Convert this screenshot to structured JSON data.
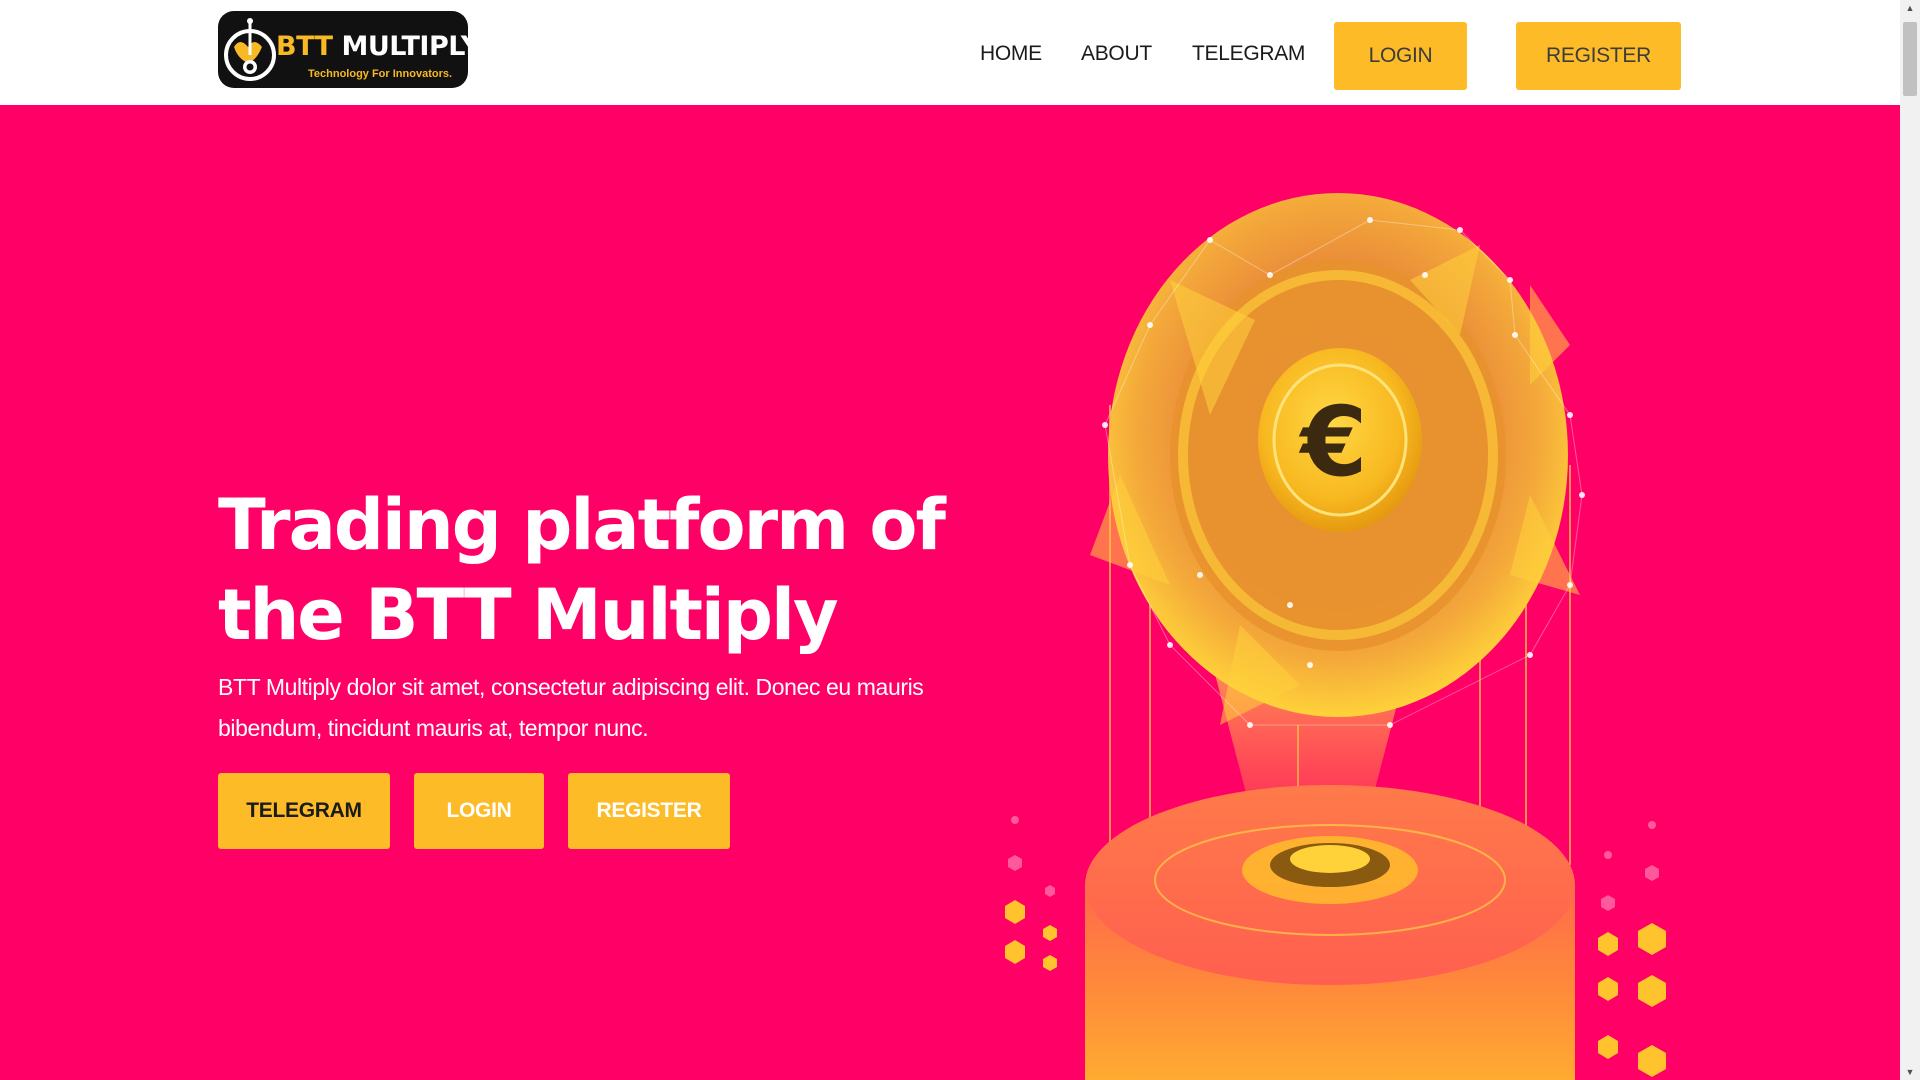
{
  "header": {
    "logo": {
      "name_first": "BTT",
      "name_second": "MULTIPLY",
      "tagline": "Technology For Innovators."
    },
    "nav": {
      "home": "HOME",
      "about": "ABOUT",
      "telegram": "TELEGRAM",
      "login": "LOGIN",
      "register": "REGISTER"
    }
  },
  "hero": {
    "title": "Trading platform of the BTT Multiply",
    "description": "BTT Multiply dolor sit amet, consectetur adipiscing elit. Donec eu mauris bibendum, tincidunt mauris at, tempor nunc.",
    "buttons": {
      "telegram": "TELEGRAM",
      "login": "LOGIN",
      "register": "REGISTER"
    },
    "coin_symbol": "€"
  },
  "colors": {
    "hero_background": "#ff0066",
    "button_yellow": "#fdbb27",
    "header_background": "#ffffff"
  },
  "icons": {
    "scroll_up": "scroll-up-arrow-icon",
    "scroll_down": "scroll-down-arrow-icon"
  }
}
